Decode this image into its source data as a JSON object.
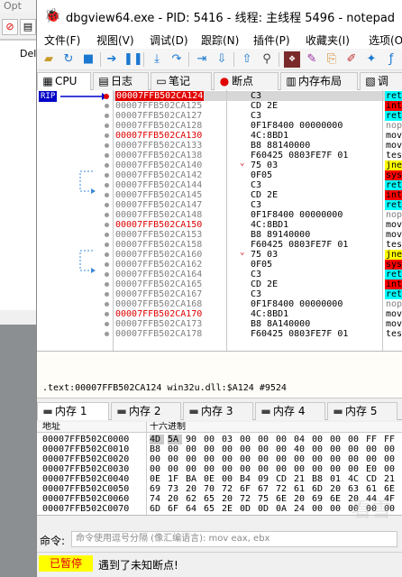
{
  "background_app": {
    "menu_partial": "Opt",
    "menu_partial2": "‹",
    "text_partial": "Del"
  },
  "window": {
    "title": "dbgview64.exe - PID: 5416 - 线程: 主线程 5496 - notepad"
  },
  "menu": [
    "文件(F)",
    "视图(V)",
    "调试(D)",
    "跟踪(N)",
    "插件(P)",
    "收藏夹(I)",
    "选项(O"
  ],
  "tabs": [
    {
      "label": "CPU",
      "icon": "cpu-icon"
    },
    {
      "label": "日志",
      "icon": "log-icon"
    },
    {
      "label": "笔记",
      "icon": "notes-icon"
    },
    {
      "label": "断点",
      "icon": "breakpoint-icon"
    },
    {
      "label": "内存布局",
      "icon": "memory-map-icon"
    },
    {
      "label": "调",
      "icon": "callstack-icon"
    }
  ],
  "disasm": {
    "rip_label": "RIP",
    "rows": [
      {
        "addr": "00007FFB502CA124",
        "hex": "C3",
        "mn": "ret",
        "mnc": "ret",
        "sel": true
      },
      {
        "addr": "00007FFB502CA125",
        "hex": "CD 2E",
        "mn": "int",
        "mnc": "int"
      },
      {
        "addr": "00007FFB502CA127",
        "hex": "C3",
        "mn": "ret",
        "mnc": "ret"
      },
      {
        "addr": "00007FFB502CA128",
        "hex": "0F1F8400 00000000",
        "mn": "nop",
        "mnc": "nop"
      },
      {
        "addr": "00007FFB502CA130",
        "hex": "4C:8BD1",
        "mn": "mov",
        "mnc": "mov",
        "red": true
      },
      {
        "addr": "00007FFB502CA133",
        "hex": "B8 88140000",
        "mn": "mov",
        "mnc": "mov"
      },
      {
        "addr": "00007FFB502CA138",
        "hex": "F60425 0803FE7F 01",
        "mn": "tes",
        "mnc": "test"
      },
      {
        "addr": "00007FFB502CA140",
        "hex": "75 03",
        "mn": "jne",
        "mnc": "jne",
        "jump": "v"
      },
      {
        "addr": "00007FFB502CA142",
        "hex": "0F05",
        "mn": "sys",
        "mnc": "ud"
      },
      {
        "addr": "00007FFB502CA144",
        "hex": "C3",
        "mn": "ret",
        "mnc": "ret"
      },
      {
        "addr": "00007FFB502CA145",
        "hex": "CD 2E",
        "mn": "int",
        "mnc": "int"
      },
      {
        "addr": "00007FFB502CA147",
        "hex": "C3",
        "mn": "ret",
        "mnc": "ret"
      },
      {
        "addr": "00007FFB502CA148",
        "hex": "0F1F8400 00000000",
        "mn": "nop",
        "mnc": "nop"
      },
      {
        "addr": "00007FFB502CA150",
        "hex": "4C:8BD1",
        "mn": "mov",
        "mnc": "mov",
        "red": true
      },
      {
        "addr": "00007FFB502CA153",
        "hex": "B8 89140000",
        "mn": "mov",
        "mnc": "mov"
      },
      {
        "addr": "00007FFB502CA158",
        "hex": "F60425 0803FE7F 01",
        "mn": "tes",
        "mnc": "test"
      },
      {
        "addr": "00007FFB502CA160",
        "hex": "75 03",
        "mn": "jne",
        "mnc": "jne",
        "jump": "v"
      },
      {
        "addr": "00007FFB502CA162",
        "hex": "0F05",
        "mn": "sys",
        "mnc": "ud"
      },
      {
        "addr": "00007FFB502CA164",
        "hex": "C3",
        "mn": "ret",
        "mnc": "ret"
      },
      {
        "addr": "00007FFB502CA165",
        "hex": "CD 2E",
        "mn": "int",
        "mnc": "int"
      },
      {
        "addr": "00007FFB502CA167",
        "hex": "C3",
        "mn": "ret",
        "mnc": "ret"
      },
      {
        "addr": "00007FFB502CA168",
        "hex": "0F1F8400 00000000",
        "mn": "nop",
        "mnc": "nop"
      },
      {
        "addr": "00007FFB502CA170",
        "hex": "4C:8BD1",
        "mn": "mov",
        "mnc": "mov",
        "red": true
      },
      {
        "addr": "00007FFB502CA173",
        "hex": "B8 8A140000",
        "mn": "mov",
        "mnc": "mov"
      },
      {
        "addr": "00007FFB502CA178",
        "hex": "F60425 0803FE7F 01",
        "mn": "tes",
        "mnc": "test"
      }
    ]
  },
  "info_line": ".text:00007FFB502CA124 win32u.dll:$A124 #9524",
  "dump_tabs": [
    "内存 1",
    "内存 2",
    "内存 3",
    "内存 4",
    "内存 5"
  ],
  "dump_header": {
    "addr": "地址",
    "hex": "十六进制"
  },
  "dump_rows": [
    {
      "addr": "00007FFB502C0000",
      "bytes": [
        "4D",
        "5A",
        "90",
        "00",
        "03",
        "00",
        "00",
        "00",
        "04",
        "00",
        "00",
        "00",
        "FF",
        "FF"
      ]
    },
    {
      "addr": "00007FFB502C0010",
      "bytes": [
        "B8",
        "00",
        "00",
        "00",
        "00",
        "00",
        "00",
        "00",
        "40",
        "00",
        "00",
        "00",
        "00",
        "00"
      ]
    },
    {
      "addr": "00007FFB502C0020",
      "bytes": [
        "00",
        "00",
        "00",
        "00",
        "00",
        "00",
        "00",
        "00",
        "00",
        "00",
        "00",
        "00",
        "00",
        "00"
      ]
    },
    {
      "addr": "00007FFB502C0030",
      "bytes": [
        "00",
        "00",
        "00",
        "00",
        "00",
        "00",
        "00",
        "00",
        "00",
        "00",
        "00",
        "00",
        "E0",
        "00"
      ]
    },
    {
      "addr": "00007FFB502C0040",
      "bytes": [
        "0E",
        "1F",
        "BA",
        "0E",
        "00",
        "B4",
        "09",
        "CD",
        "21",
        "B8",
        "01",
        "4C",
        "CD",
        "21"
      ]
    },
    {
      "addr": "00007FFB502C0050",
      "bytes": [
        "69",
        "73",
        "20",
        "70",
        "72",
        "6F",
        "67",
        "72",
        "61",
        "6D",
        "20",
        "63",
        "61",
        "6E"
      ]
    },
    {
      "addr": "00007FFB502C0060",
      "bytes": [
        "74",
        "20",
        "62",
        "65",
        "20",
        "72",
        "75",
        "6E",
        "20",
        "69",
        "6E",
        "20",
        "44",
        "4F"
      ]
    },
    {
      "addr": "00007FFB502C0070",
      "bytes": [
        "6D",
        "6F",
        "64",
        "65",
        "2E",
        "0D",
        "0D",
        "0A",
        "24",
        "00",
        "00",
        "00",
        "00",
        "00"
      ]
    }
  ],
  "command": {
    "label": "命令:",
    "placeholder": "命令使用逗号分隔 (像汇编语言): mov eax, ebx"
  },
  "status": {
    "state": "已暂停",
    "message": "遇到了未知断点!"
  },
  "watermark": "看雪"
}
